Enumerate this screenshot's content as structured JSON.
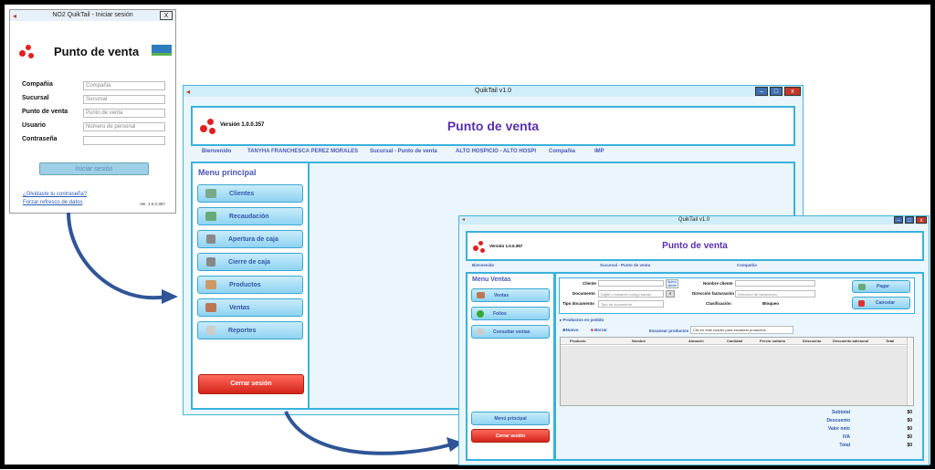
{
  "login": {
    "title": "NO2 QuikTail - Iniciar sesión",
    "close": "X",
    "app_title": "Punto de venta",
    "labels": {
      "company": "Compañia",
      "branch": "Sucursal",
      "pos": "Punto de venta",
      "user": "Usuario",
      "password": "Contraseña"
    },
    "fields": {
      "company": "Compañia",
      "branch": "Sucursal",
      "pos": "Punto de venta",
      "user": "Número de personal",
      "password": ""
    },
    "login_btn": "Iniciar sesión",
    "forgot": "¿Olvidaste tu contraseña?",
    "refresh": "Forzar refresco de datos",
    "version": "Ver. 1.0.0.357"
  },
  "main": {
    "title": "QuikTail v1.0",
    "version": "Versión 1.0.0.357",
    "app_title": "Punto de venta",
    "info": [
      "Bienvenido",
      "TANYHA FRANCHESCA PEREZ MORALES",
      "Sucursal - Punto de venta",
      "ALTO HOSPICIO - ALTO HOSPI",
      "Compañia",
      "IMP"
    ],
    "menu_title": "Menu principal",
    "menu": [
      "Clientes",
      "Recaudación",
      "Apertura de caja",
      "Cierre de caja",
      "Productos",
      "Ventas",
      "Reportes"
    ],
    "logout": "Cerrar sesión"
  },
  "sales": {
    "title": "QuikTail v1.0",
    "version": "Versión 1.0.0.357",
    "app_title": "Punto de venta",
    "info": [
      "Bienvenido",
      "Sucursal - Punto de venta",
      "Compañia"
    ],
    "menu_title": "Menu Ventas",
    "menu": [
      "Ventas",
      "Folios",
      "Consultar ventas"
    ],
    "form": {
      "client_label": "Cliente",
      "new_client": "Nuevo cliente",
      "client_name_label": "Nombre cliente",
      "doc_label": "Documento",
      "doc_placeholder": "Digite o escanee código barras",
      "billing_label": "Dirección facturación",
      "billing_placeholder": "Dirección de facturación",
      "doctype_label": "Tipo documento",
      "doctype_value": "Tipo de documento",
      "classification_label": "Clasificación",
      "blocked_label": "Bloqueo"
    },
    "pay": "Pagar",
    "cancel": "Cancelar",
    "products_title": "Productos en pedido",
    "new": "Nuevo",
    "delete": "Borrar",
    "scan_label": "Escanear productos",
    "scan_placeholder": "Clic en este cuadro para escanear productos",
    "columns": [
      "Producto",
      "Nombre",
      "Almacén",
      "Cantidad",
      "Precio unitario",
      "Descuento",
      "Descuento adicional",
      "Total"
    ],
    "totals": [
      {
        "label": "Subtotal",
        "value": "$0"
      },
      {
        "label": "Descuento",
        "value": "$0"
      },
      {
        "label": "Valor neto",
        "value": "$0"
      },
      {
        "label": "IVA",
        "value": "$0"
      },
      {
        "label": "Total",
        "value": "$0"
      }
    ],
    "main_menu": "Menú principal",
    "logout": "Cerrar sesión"
  },
  "colors": {
    "accent": "#3bb1dc",
    "title": "#5a2fb0",
    "red": "#d4231b",
    "titlebar": "#cfeef9"
  }
}
